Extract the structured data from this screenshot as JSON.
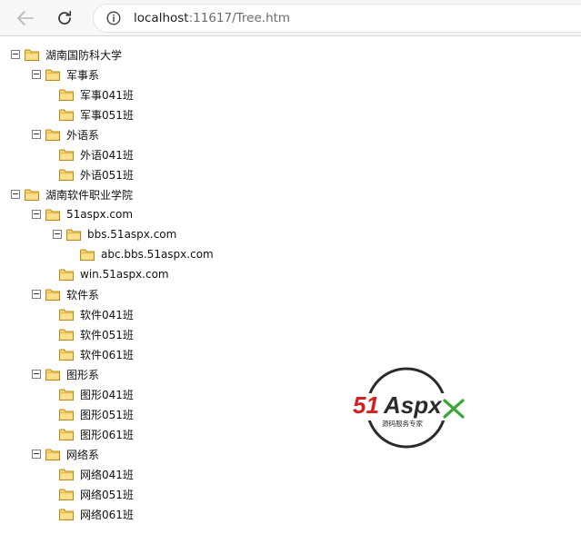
{
  "browser": {
    "url_host": "localhost",
    "url_rest": ":11617/Tree.htm"
  },
  "tree": [
    {
      "label": "湖南国防科大学",
      "depth": 0,
      "expandable": true
    },
    {
      "label": "军事系",
      "depth": 1,
      "expandable": true
    },
    {
      "label": "军事041班",
      "depth": 2,
      "expandable": false
    },
    {
      "label": "军事051班",
      "depth": 2,
      "expandable": false
    },
    {
      "label": "外语系",
      "depth": 1,
      "expandable": true
    },
    {
      "label": "外语041班",
      "depth": 2,
      "expandable": false
    },
    {
      "label": "外语051班",
      "depth": 2,
      "expandable": false
    },
    {
      "label": "湖南软件职业学院",
      "depth": 0,
      "expandable": true
    },
    {
      "label": "51aspx.com",
      "depth": 1,
      "expandable": true
    },
    {
      "label": "bbs.51aspx.com",
      "depth": 2,
      "expandable": true
    },
    {
      "label": "abc.bbs.51aspx.com",
      "depth": 3,
      "expandable": false
    },
    {
      "label": "win.51aspx.com",
      "depth": 2,
      "expandable": false
    },
    {
      "label": "软件系",
      "depth": 1,
      "expandable": true
    },
    {
      "label": "软件041班",
      "depth": 2,
      "expandable": false
    },
    {
      "label": "软件051班",
      "depth": 2,
      "expandable": false
    },
    {
      "label": "软件061班",
      "depth": 2,
      "expandable": false
    },
    {
      "label": "图形系",
      "depth": 1,
      "expandable": true
    },
    {
      "label": "图形041班",
      "depth": 2,
      "expandable": false
    },
    {
      "label": "图形051班",
      "depth": 2,
      "expandable": false
    },
    {
      "label": "图形061班",
      "depth": 2,
      "expandable": false
    },
    {
      "label": "网络系",
      "depth": 1,
      "expandable": true
    },
    {
      "label": "网络041班",
      "depth": 2,
      "expandable": false
    },
    {
      "label": "网络051班",
      "depth": 2,
      "expandable": false
    },
    {
      "label": "网络061班",
      "depth": 2,
      "expandable": false
    }
  ],
  "watermark": {
    "brand_red": "51",
    "brand_dark": "Aspx",
    "tagline": "源码服务专家",
    "colors": {
      "red": "#d42020",
      "dark": "#2b2b2b",
      "green": "#3aa635"
    }
  },
  "colors": {
    "folder_fill": "#f7d56b",
    "folder_stroke": "#b58a1a"
  }
}
